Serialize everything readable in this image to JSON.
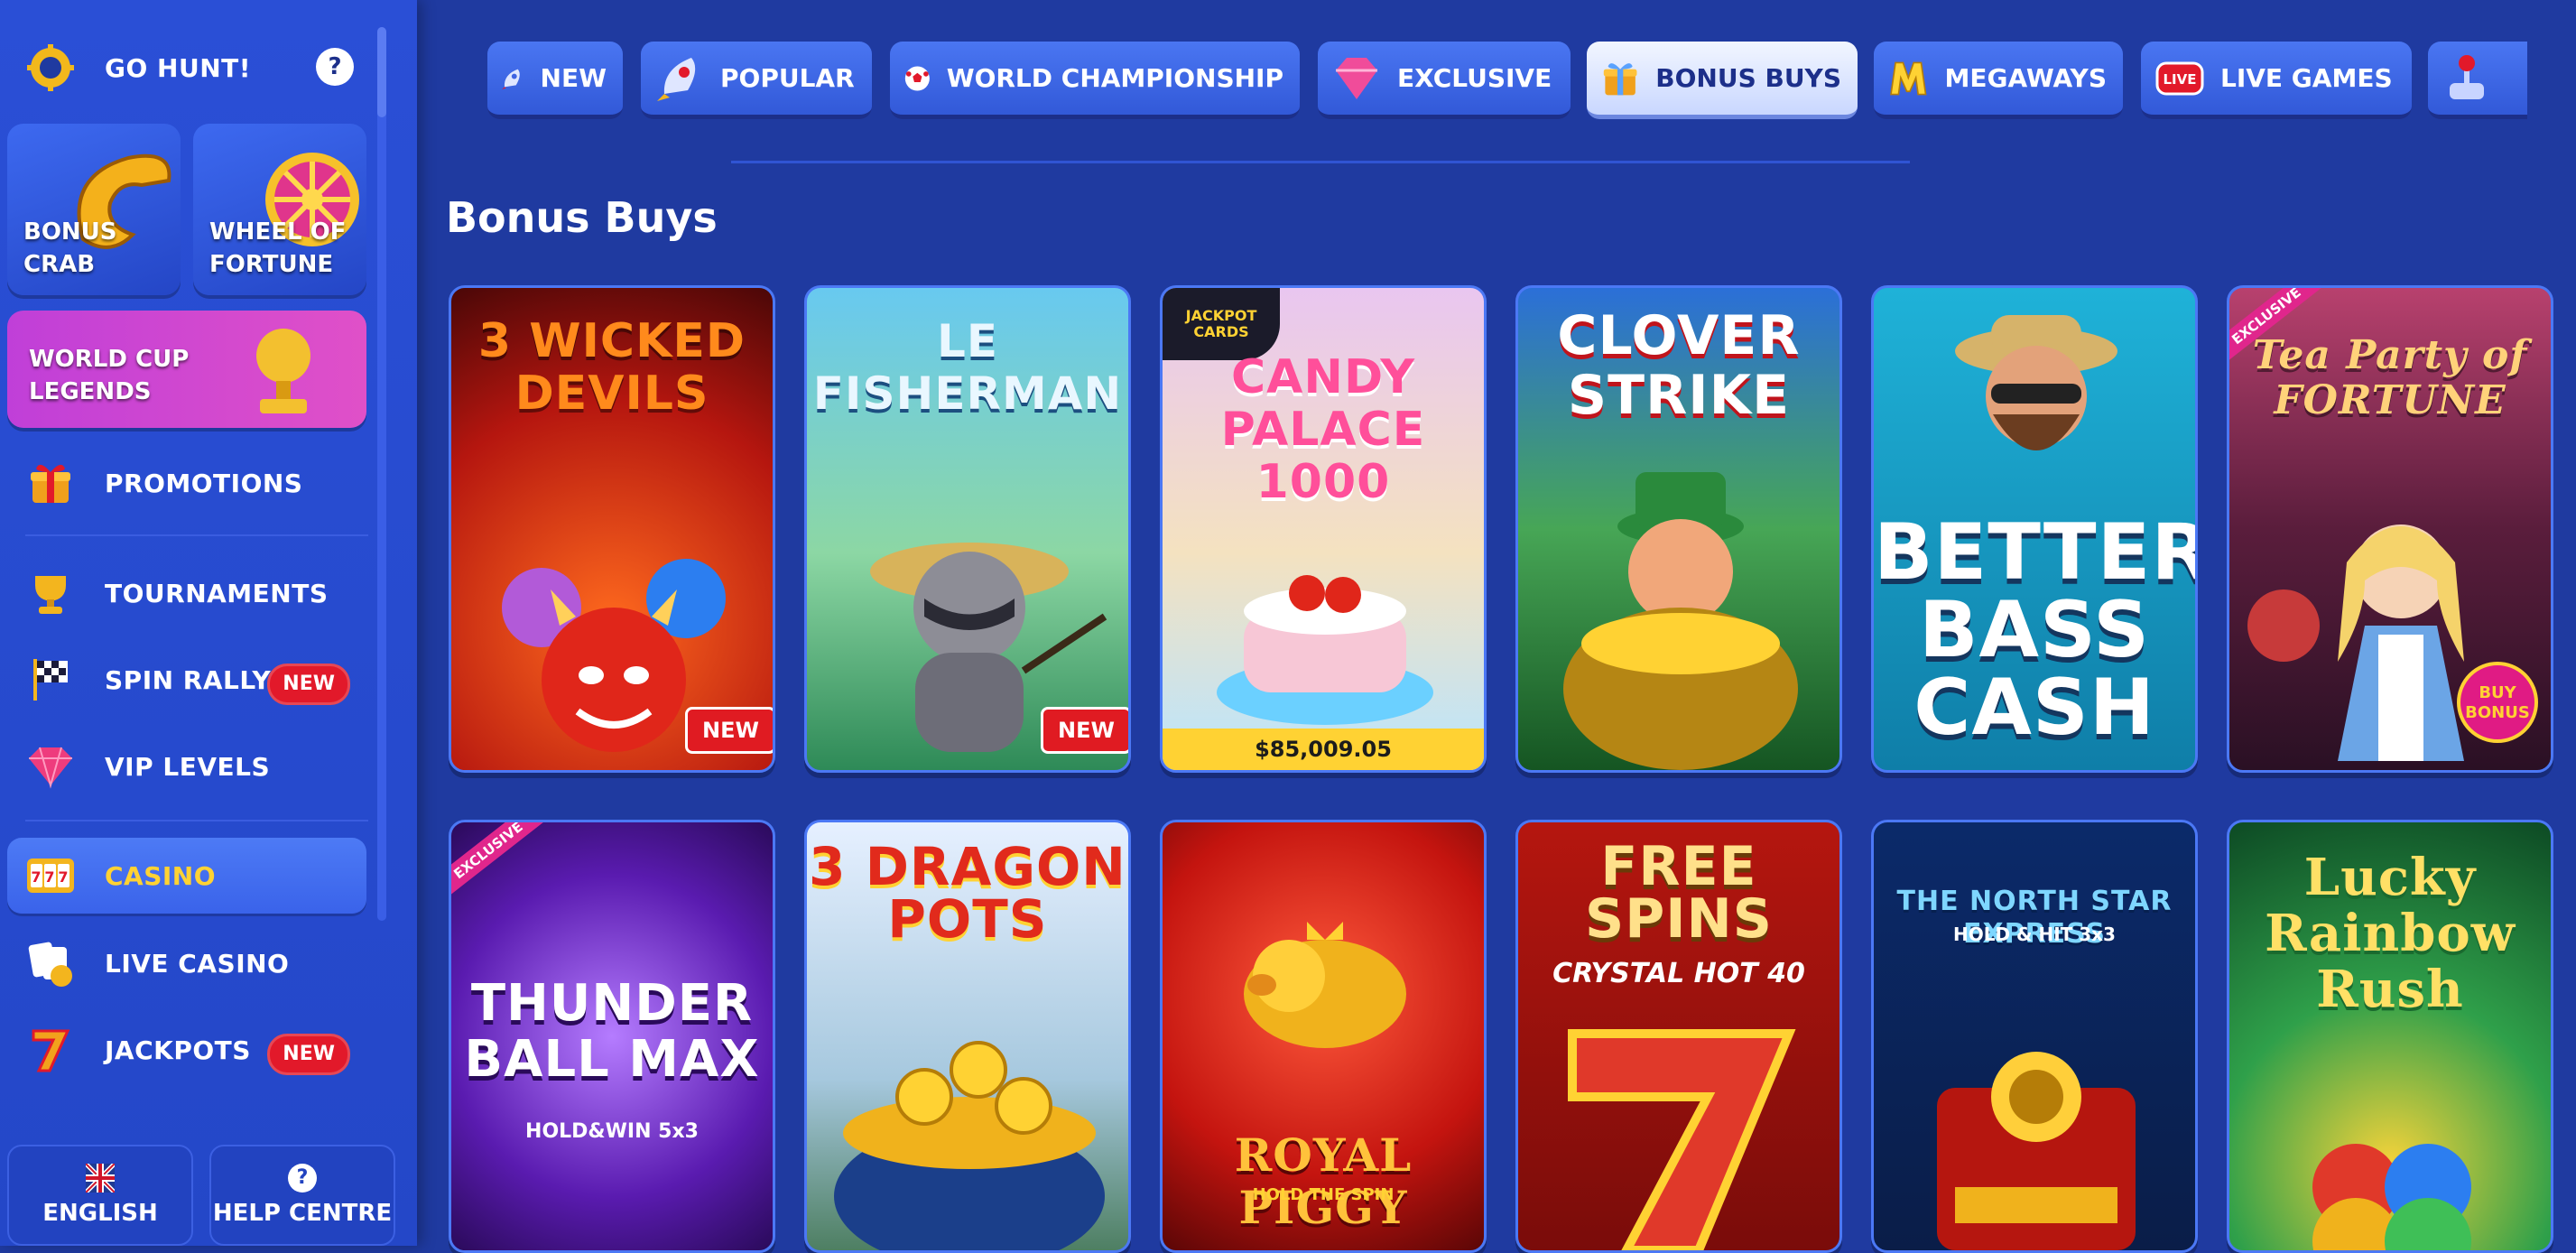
{
  "sidebar": {
    "go_hunt": "GO HUNT!",
    "help_q": "?",
    "tiles": {
      "bonus_crab": "BONUS CRAB",
      "wheel_of_fortune": "WHEEL OF FORTUNE",
      "world_cup_legends": "WORLD CUP LEGENDS"
    },
    "items": [
      {
        "label": "PROMOTIONS",
        "icon": "gift-icon"
      },
      {
        "label": "TOURNAMENTS",
        "icon": "trophy-icon"
      },
      {
        "label": "SPIN RALLY",
        "icon": "checkered-flag-icon",
        "badge": "NEW"
      },
      {
        "label": "VIP LEVELS",
        "icon": "diamond-icon"
      },
      {
        "label": "CASINO",
        "icon": "slot-machine-icon",
        "active": true
      },
      {
        "label": "LIVE CASINO",
        "icon": "cards-icon"
      },
      {
        "label": "JACKPOTS",
        "icon": "seven-icon",
        "badge": "NEW"
      }
    ],
    "language_button": "ENGLISH",
    "help_button": "HELP CENTRE",
    "help_button_icon": "?"
  },
  "categories": [
    {
      "label": "NEW",
      "icon": "rocket-icon"
    },
    {
      "label": "POPULAR",
      "icon": "rocket-icon"
    },
    {
      "label": "WORLD CHAMPIONSHIP",
      "icon": "football-icon"
    },
    {
      "label": "EXCLUSIVE",
      "icon": "diamond-icon"
    },
    {
      "label": "BONUS BUYS",
      "icon": "gift-icon",
      "active": true
    },
    {
      "label": "MEGAWAYS",
      "icon": "m-letter-icon"
    },
    {
      "label": "LIVE GAMES",
      "icon": "live-icon"
    }
  ],
  "section_title": "Bonus Buys",
  "games_row1": [
    {
      "title": "3 WICKED DEVILS",
      "badge": "NEW"
    },
    {
      "title": "LE FISHERMAN",
      "badge": "NEW"
    },
    {
      "title": "CANDY PALACE 1000",
      "corner": "JACKPOT CARDS",
      "price": "$85,009.05"
    },
    {
      "title": "CLOVER STRIKE"
    },
    {
      "title": "BETTER BASS CASH"
    },
    {
      "title": "Tea Party of FORTUNE",
      "ribbon": "EXCLUSIVE",
      "sticker": "BUY BONUS"
    }
  ],
  "games_row2": [
    {
      "title": "THUNDER BALL MAX",
      "sub": "HOLD&WIN 5x3",
      "ribbon": "EXCLUSIVE"
    },
    {
      "title": "3 DRAGON POTS"
    },
    {
      "title": "ROYAL PIGGY",
      "sub": "HOLD THE SPIN"
    },
    {
      "title": "FREE SPINS",
      "sub": "CRYSTAL HOT 40"
    },
    {
      "title": "THE NORTH STAR EXPRESS",
      "sub": "HOLD & HIT 3x3"
    },
    {
      "title": "Lucky Rainbow Rush"
    }
  ],
  "colors": {
    "background": "#1f3aa0",
    "sidebar": "#2a4fd6",
    "new_badge": "#e2192a",
    "price_bar": "#ffd233",
    "active_tab": "#eef3ff"
  }
}
